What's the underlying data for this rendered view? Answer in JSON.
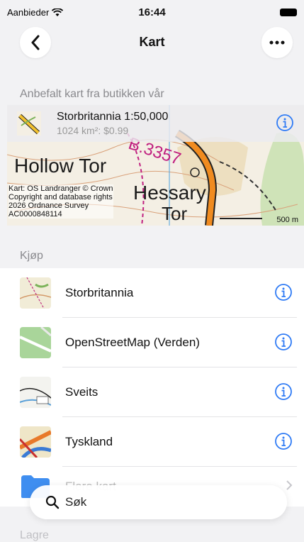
{
  "status": {
    "carrier": "Aanbieder",
    "time": "16:44"
  },
  "nav": {
    "title": "Kart"
  },
  "recommended": {
    "heading": "Anbefalt kart fra butikken vår",
    "name": "Storbritannia 1:50,000",
    "details": "1024 km²: $0.99",
    "map_labels": [
      "Hollow Tor",
      "Hessary",
      "Tor",
      "B.3357"
    ],
    "credit": [
      "Kart: OS Landranger © Crown",
      "Copyright and database rights",
      "2026 Ordnance Survey",
      "AC0000848114"
    ],
    "scale": "500 m"
  },
  "buy": {
    "heading": "Kjøp",
    "items": [
      {
        "label": "Storbritannia",
        "icon": "uk-map-thumbnail"
      },
      {
        "label": "OpenStreetMap (Verden)",
        "icon": "osm-map-thumbnail"
      },
      {
        "label": "Sveits",
        "icon": "swiss-map-thumbnail"
      },
      {
        "label": "Tyskland",
        "icon": "germany-map-thumbnail"
      },
      {
        "label": "Flere kart",
        "icon": "folder-icon"
      }
    ]
  },
  "save": {
    "heading": "Lagre"
  },
  "search": {
    "placeholder": "Søk"
  },
  "colors": {
    "accent": "#2f7bf5",
    "background": "#f2f2f4"
  }
}
